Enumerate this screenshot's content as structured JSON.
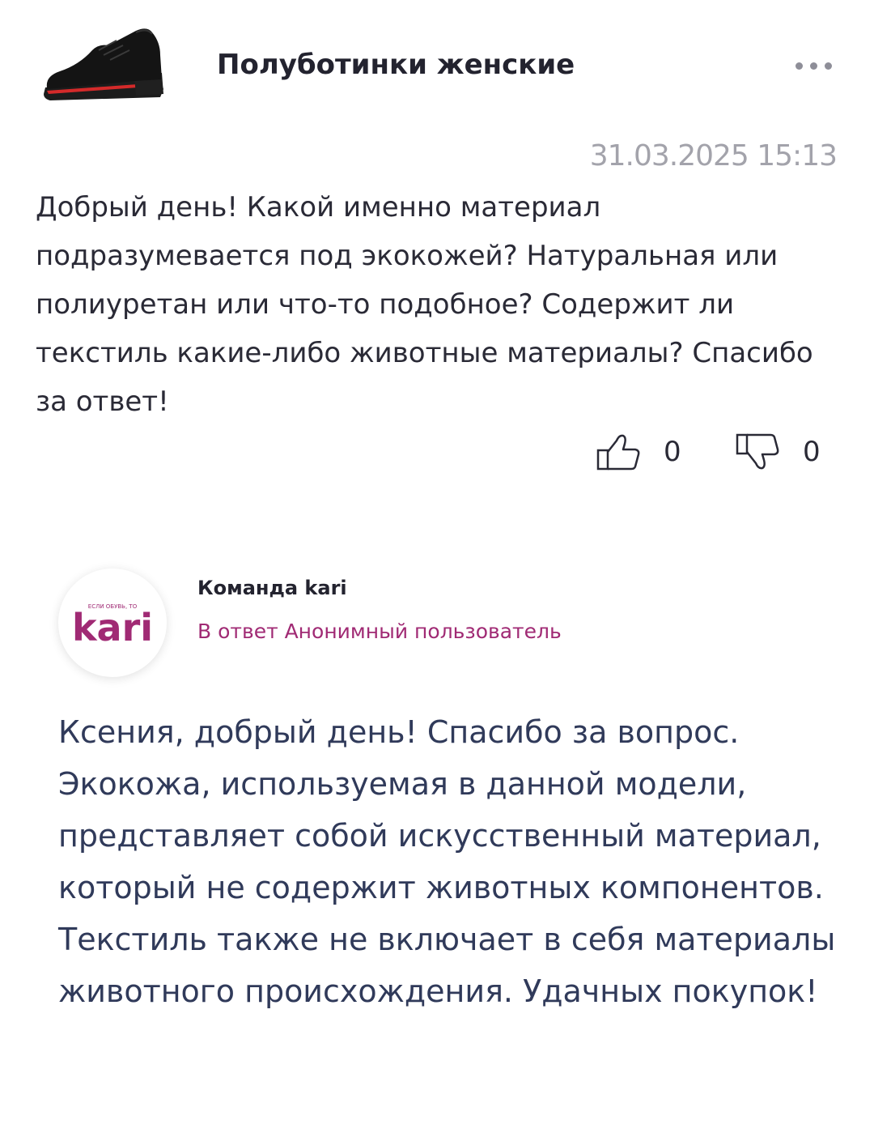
{
  "product": {
    "title": "Полуботинки женские",
    "image_icon": "shoe-product-image",
    "more_icon": "more-dots-icon"
  },
  "question": {
    "date": "31.03.2025 15:13",
    "text": "Добрый день! Какой именно материал подразумевается под экокожей? Натуральная или полиуретан или что-то подобное? Содержит ли текстиль какие-либо животные материалы? Спасибо за ответ!",
    "likes": "0",
    "dislikes": "0",
    "like_icon": "thumbs-up-icon",
    "dislike_icon": "thumbs-down-icon"
  },
  "answer": {
    "brand_name": "Команда kari",
    "logo_tagline": "ЕСЛИ ОБУВЬ, ТО",
    "logo_text": "kari",
    "reply_to": "В ответ Анонимный пользователь",
    "text": "Ксения, добрый день! Спасибо за вопрос. Экокожа, используемая в данной модели, представляет собой искусственный материал, который не содержит животных компонентов. Текстиль также не включает в себя материалы животного происхождения. Удачных покупок!"
  },
  "colors": {
    "brand": "#a02a74",
    "date": "#a3a3ab",
    "answer_text": "#303a5a"
  }
}
